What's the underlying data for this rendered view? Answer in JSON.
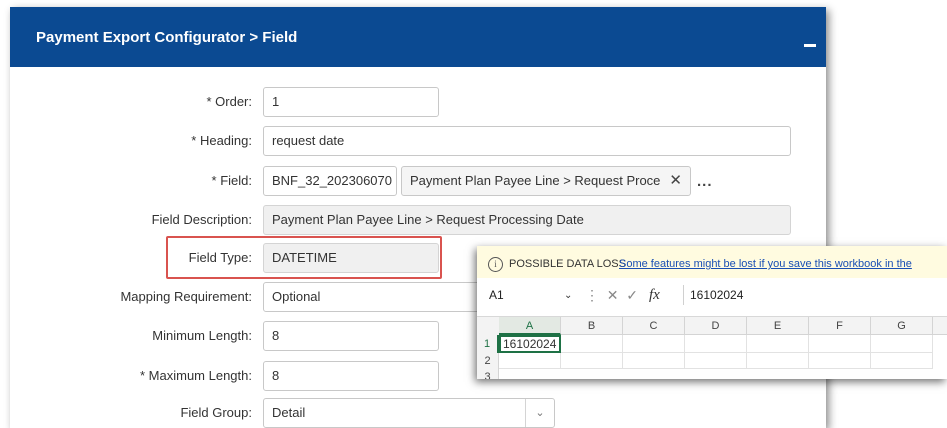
{
  "panel": {
    "title": "Payment Export Configurator > Field",
    "header_color": "#0b4a92"
  },
  "form": {
    "order": {
      "label": "* Order:",
      "value": "1"
    },
    "heading": {
      "label": "* Heading:",
      "value": "request date"
    },
    "field": {
      "label": "* Field:",
      "value": "BNF_32_202306070",
      "tag": "Payment Plan Payee Line > Request Proce",
      "tag_close": "✕",
      "more": "..."
    },
    "field_description": {
      "label": "Field Description:",
      "value": "Payment Plan Payee Line > Request Processing Date"
    },
    "field_type": {
      "label": "Field Type:",
      "value": "DATETIME"
    },
    "mapping_requirement": {
      "label": "Mapping Requirement:",
      "value": "Optional"
    },
    "minimum_length": {
      "label": "Minimum Length:",
      "value": "8"
    },
    "maximum_length": {
      "label": "* Maximum Length:",
      "value": "8"
    },
    "field_group": {
      "label": "Field Group:",
      "value": "Detail"
    }
  },
  "excel": {
    "warning_title": "POSSIBLE DATA LOSS",
    "warning_message": "Some features might be lost if you save this workbook in the",
    "name_box": "A1",
    "formula_value": "16102024",
    "columns": [
      "A",
      "B",
      "C",
      "D",
      "E",
      "F",
      "G"
    ],
    "rows": [
      "1",
      "2",
      "3"
    ],
    "cell_a1": "16102024",
    "accent_color": "#1e7145"
  }
}
